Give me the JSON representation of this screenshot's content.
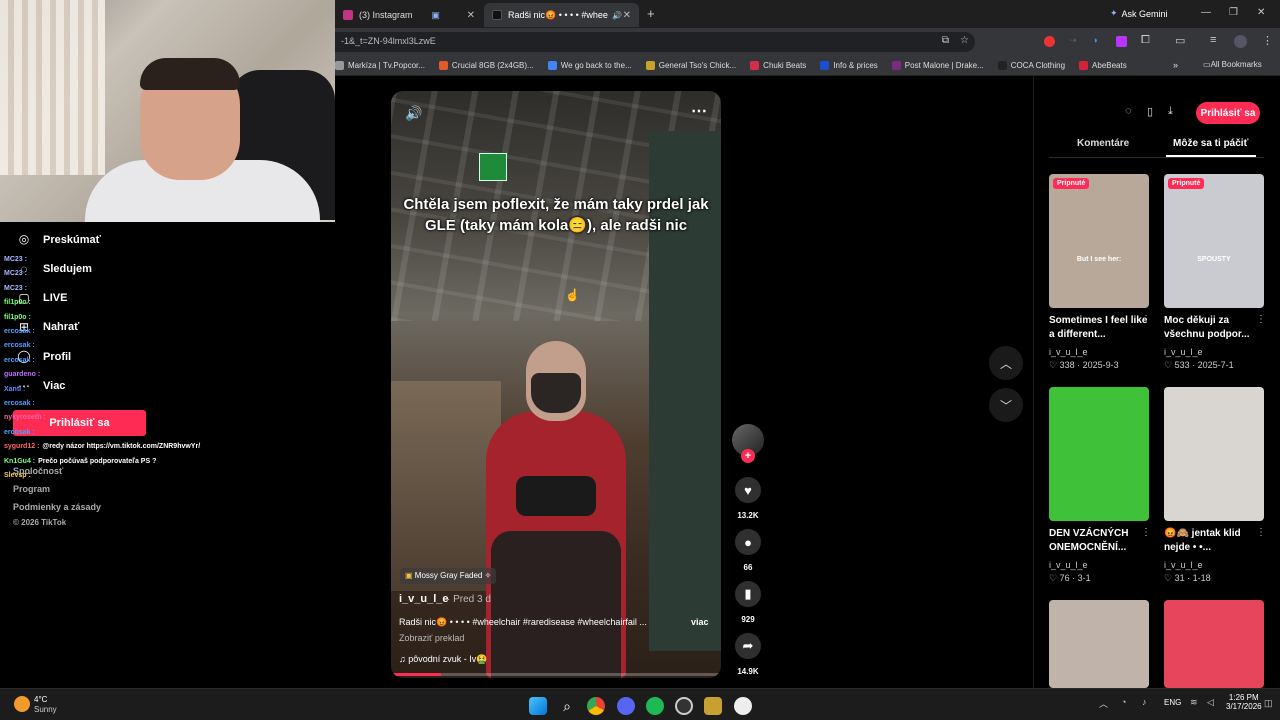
{
  "browser": {
    "tabs": [
      {
        "label": "(3) Instagram",
        "color": "#c13584"
      },
      {
        "label": "Radši nic😡 • • • • #wheelch",
        "color": "#111111"
      }
    ],
    "new_tab": "+",
    "ask_gemini": "Ask Gemini",
    "url": "-1&_t=ZN-94lmxl3LzwE",
    "bookmarks": [
      {
        "label": "Markíza | Tv.Popcor...",
        "color": "#999999"
      },
      {
        "label": "Crucial 8GB (2x4GB)...",
        "color": "#e05a2b"
      },
      {
        "label": "We go back to the...",
        "color": "#4285f4"
      },
      {
        "label": "General Tso's Chick...",
        "color": "#c9a227"
      },
      {
        "label": "Chuki Beats",
        "color": "#d62d4b"
      },
      {
        "label": "Info & prices",
        "color": "#1b4fd1"
      },
      {
        "label": "Post Malone | Drake...",
        "color": "#7a2b7f"
      },
      {
        "label": "COCA Clothing",
        "color": "#222222"
      },
      {
        "label": "AbeBeats",
        "color": "#d6213a"
      }
    ],
    "all_bookmarks": "All Bookmarks"
  },
  "left_nav": {
    "items": [
      "Preskúmať",
      "Sledujem",
      "LIVE",
      "Nahrať",
      "Profil",
      "Viac"
    ],
    "login": "Prihlásiť sa",
    "footer": [
      "Spoločnosť",
      "Program",
      "Podmienky a zásady",
      "© 2026 TikTok"
    ]
  },
  "chat": [
    {
      "user": "MC23 :",
      "msg": "",
      "color": "#a8b8ff"
    },
    {
      "user": "MC23 :",
      "msg": "",
      "color": "#a8b8ff"
    },
    {
      "user": "MC23 :",
      "msg": "",
      "color": "#a8b8ff"
    },
    {
      "user": "fil1p0o :",
      "msg": "",
      "color": "#7cff7c"
    },
    {
      "user": "fil1p0o :",
      "msg": "",
      "color": "#7cff7c"
    },
    {
      "user": "ercosak :",
      "msg": "",
      "color": "#4da3ff"
    },
    {
      "user": "ercosak :",
      "msg": "",
      "color": "#4da3ff"
    },
    {
      "user": "ercosak :",
      "msg": "",
      "color": "#4da3ff"
    },
    {
      "user": "guardeno :",
      "msg": "",
      "color": "#c06cff"
    },
    {
      "user": "Xanti :",
      "msg": "",
      "color": "#5b8cff"
    },
    {
      "user": "ercosak :",
      "msg": "",
      "color": "#4da3ff"
    },
    {
      "user": "nykyroseth :",
      "msg": "",
      "color": "#ff5fa0"
    },
    {
      "user": "ercosak :",
      "msg": "",
      "color": "#4da3ff"
    },
    {
      "user": "sygurd12 :",
      "msg": "@redy názor https://vm.tiktok.com/ZNR9hvwYr/",
      "color": "#ff6a6a"
    },
    {
      "user": "Kn1Gu4 :",
      "msg": "Prečo počúvaš podporovateľa PS ?",
      "color": "#7cff7c"
    },
    {
      "user": "Slevsp :",
      "msg": "",
      "color": "#ffcc44"
    }
  ],
  "video": {
    "caption": "Chtěla jsem poflexit, že mám taky prdel jak GLE (taky mám kola😑), ale radši nic",
    "effect": "Mossy Gray Faded ✧",
    "author": "i_v_u_l_e",
    "time": "· Pred 3 d",
    "description": "Radši nic😡 • • • • #wheelchair #raredisease #wheelchairfail ...",
    "more": "viac",
    "translate": "Zobraziť preklad",
    "sound": "pôvodní zvuk - Iv🤮",
    "progress": 0.15
  },
  "actions": {
    "likes": "13.2K",
    "comments": "66",
    "saves": "929",
    "shares": "14.9K"
  },
  "right_panel": {
    "login": "Prihlásiť sa",
    "tabs": [
      "Komentáre",
      "Môže sa ti páčiť"
    ],
    "cards": [
      {
        "pinned": "Pripnuté",
        "title": "Sometimes I feel like a different...",
        "author": "i_v_u_l_e",
        "likes": "338",
        "date": "2025-9-3",
        "overlay": "But I see her:",
        "bg": "#b7a89a"
      },
      {
        "pinned": "Pripnuté",
        "title": "Moc děkuji za všechnu podpor...",
        "author": "i_v_u_l_e",
        "likes": "533",
        "date": "2025-7-1",
        "overlay": "SPOUSTY",
        "bg": "#c9cbd0"
      },
      {
        "pinned": "",
        "title": "DEN VZÁCNÝCH ONEMOCNĚNÍ...",
        "author": "i_v_u_l_e",
        "likes": "76",
        "date": "3-1",
        "overlay": "",
        "bg": "#3fc23a"
      },
      {
        "pinned": "",
        "title": "😡🙈 jentak klid nejde • •...",
        "author": "i_v_u_l_e",
        "likes": "31",
        "date": "1-18",
        "overlay": "",
        "bg": "#d9d6d2"
      },
      {
        "pinned": "",
        "title": "",
        "author": "",
        "likes": "",
        "date": "",
        "overlay": "",
        "bg": "#bfb3aa"
      },
      {
        "pinned": "",
        "title": "",
        "author": "",
        "likes": "",
        "date": "",
        "overlay": "",
        "bg": "#e7455c"
      }
    ]
  },
  "taskbar": {
    "weather_temp": "4°C",
    "weather_desc": "Sunny",
    "lang": "ENG",
    "time": "1:26 PM",
    "date": "3/17/2026"
  }
}
